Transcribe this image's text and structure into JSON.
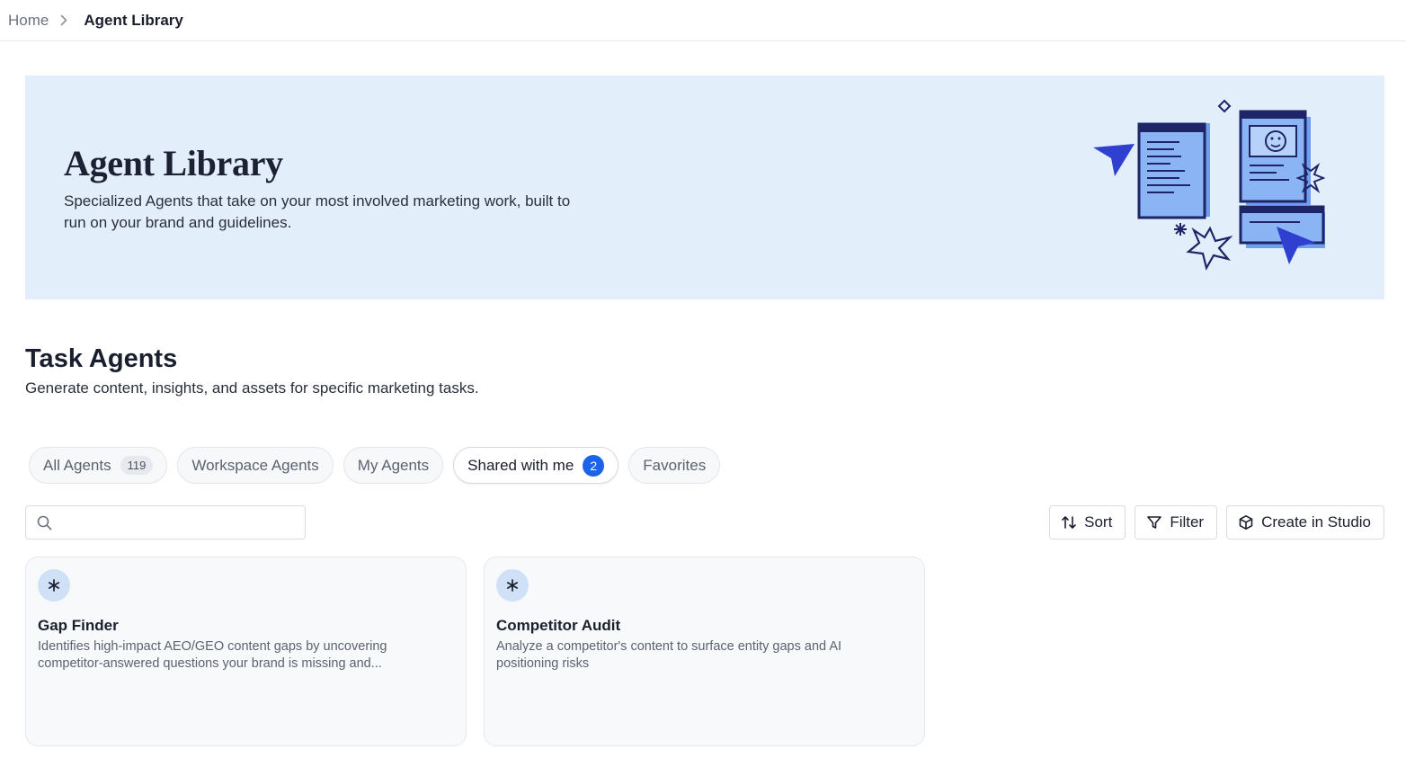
{
  "breadcrumb": {
    "home": "Home",
    "current": "Agent Library"
  },
  "hero": {
    "title": "Agent Library",
    "description": "Specialized Agents that take on your most involved marketing work, built to run on your brand and guidelines."
  },
  "section": {
    "title": "Task Agents",
    "description": "Generate content, insights, and assets for specific marketing tasks."
  },
  "tabs": [
    {
      "label": "All Agents",
      "count": "119"
    },
    {
      "label": "Workspace Agents"
    },
    {
      "label": "My Agents"
    },
    {
      "label": "Shared with me",
      "badge": "2",
      "active": true
    },
    {
      "label": "Favorites"
    }
  ],
  "search": {
    "placeholder": "",
    "value": ""
  },
  "actions": {
    "sort": "Sort",
    "filter": "Filter",
    "create": "Create in Studio"
  },
  "cards": [
    {
      "title": "Gap Finder",
      "description": "Identifies high-impact AEO/GEO content gaps by uncovering competitor-answered questions your brand is missing and...",
      "icon": "asterisk-icon"
    },
    {
      "title": "Competitor Audit",
      "description": "Analyze a competitor's content to surface entity gaps and AI positioning risks",
      "icon": "asterisk-icon"
    }
  ],
  "colors": {
    "accent": "#1b63e8",
    "hero_bg": "#e3eefb",
    "illustration_blue": "#2f3fcf"
  }
}
